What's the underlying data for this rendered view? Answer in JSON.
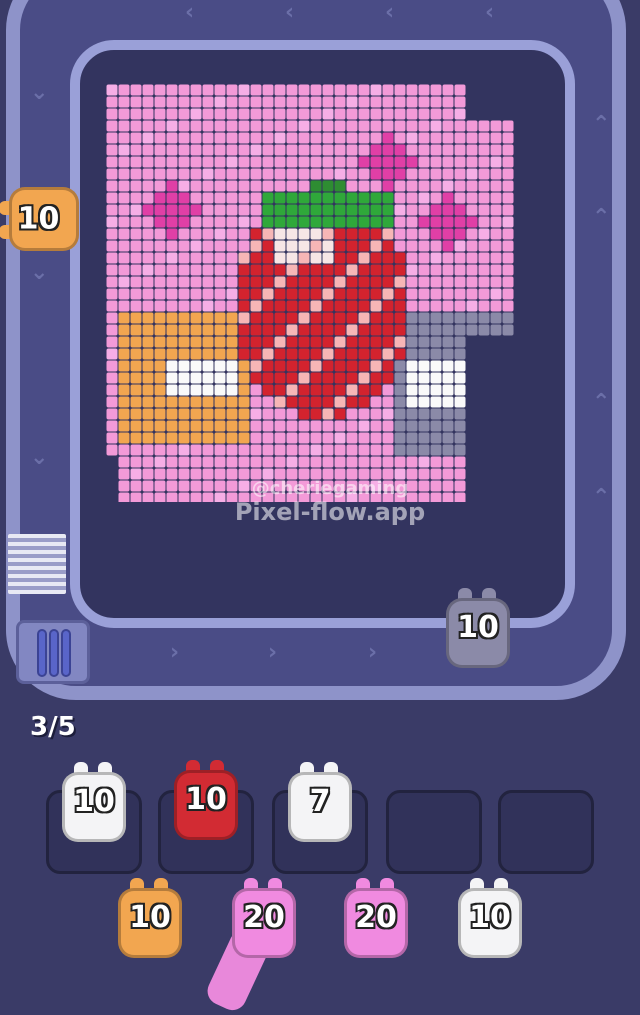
{
  "board": {
    "watermark_user": "@cheriegaming",
    "watermark_site": "Pixel-flow.app"
  },
  "conveyor": {
    "shooters": [
      {
        "label": "10",
        "color": "#f2a650",
        "name": "orange"
      },
      {
        "label": "10",
        "color": "#8b8aa8",
        "name": "gray"
      }
    ]
  },
  "queue_counter": "3/5",
  "slots": [
    {
      "label": "10",
      "color": "#f4f4f6",
      "name": "white"
    },
    {
      "label": "10",
      "color": "#d22b33",
      "name": "red"
    },
    {
      "label": "7",
      "color": "#f4f4f6",
      "name": "white"
    },
    {
      "label": "",
      "color": "",
      "name": "empty"
    },
    {
      "label": "",
      "color": "",
      "name": "empty"
    }
  ],
  "bottom_row": [
    {
      "label": "10",
      "color": "#f2a650",
      "name": "orange"
    },
    {
      "label": "20",
      "color": "#f08ae0",
      "name": "pink"
    },
    {
      "label": "20",
      "color": "#f08ae0",
      "name": "pink"
    },
    {
      "label": "10",
      "color": "#f4f4f6",
      "name": "white"
    }
  ]
}
